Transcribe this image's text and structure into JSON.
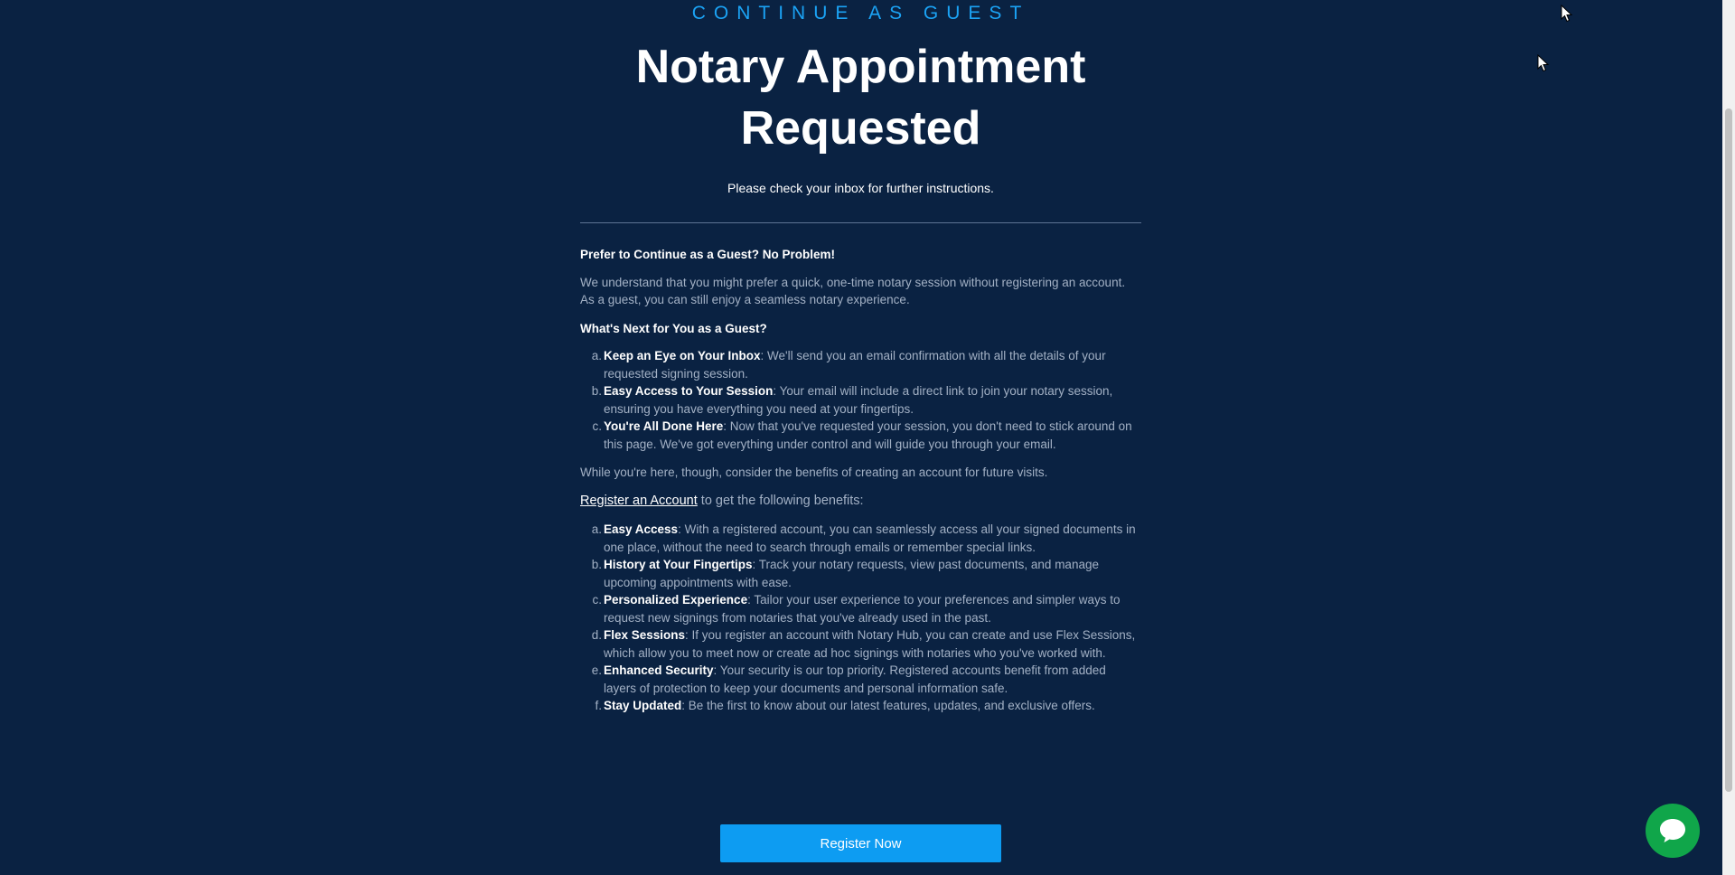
{
  "header": {
    "eyebrow": "CONTINUE AS GUEST",
    "title": "Notary Appointment Requested",
    "subtitle": "Please check your inbox for further instructions."
  },
  "guest": {
    "heading": "Prefer to Continue as a Guest? No Problem!",
    "intro": "We understand that you might prefer a quick, one-time notary session without registering an account. As a guest, you can still enjoy a seamless notary experience.",
    "next_heading": "What's Next for You as a Guest?",
    "steps": [
      {
        "marker": "a.",
        "title": "Keep an Eye on Your Inbox",
        "text": ": We'll send you an email confirmation with all the details of your requested signing session."
      },
      {
        "marker": "b.",
        "title": "Easy Access to Your Session",
        "text": ": Your email will include a direct link to join your notary session, ensuring you have everything you need at your fingertips."
      },
      {
        "marker": "c.",
        "title": "You're All Done Here",
        "text": ": Now that you've requested your session, you don't need to stick around on this page. We've got everything under control and will guide you through your email."
      }
    ],
    "consider": "While you're here, though, consider the benefits of creating an account for future visits."
  },
  "register": {
    "link_label": "Register an Account",
    "link_suffix": " to get the following benefits:",
    "benefits": [
      {
        "marker": "a.",
        "title": "Easy Access",
        "text": ": With a registered account, you can seamlessly access all your signed documents in one place, without the need to search through emails or remember special links."
      },
      {
        "marker": "b.",
        "title": "History at Your Fingertips",
        "text": ": Track your notary requests, view past documents, and manage upcoming appointments with ease."
      },
      {
        "marker": "c.",
        "title": "Personalized Experience",
        "text": ": Tailor your user experience to your preferences and simpler ways to request new signings from notaries that you've already used in the past."
      },
      {
        "marker": "d.",
        "title": "Flex Sessions",
        "text": ": If you register an account with Notary Hub, you can create and use Flex Sessions, which allow you to meet now or create ad hoc signings with notaries who you've worked with."
      },
      {
        "marker": "e.",
        "title": "Enhanced Security",
        "text": ": Your security is our top priority. Registered accounts benefit from added layers of protection to keep your documents and personal information safe."
      },
      {
        "marker": "f.",
        "title": "Stay Updated",
        "text": ": Be the first to know about our latest features, updates, and exclusive offers."
      }
    ],
    "cta_label": "Register Now"
  },
  "icons": {
    "chat": "chat-bubble-icon",
    "cursor": "mouse-cursor-icon"
  },
  "colors": {
    "background": "#0a2242",
    "accent": "#1ba3f5",
    "cta": "#0d9cf2",
    "chat": "#10a64a"
  }
}
